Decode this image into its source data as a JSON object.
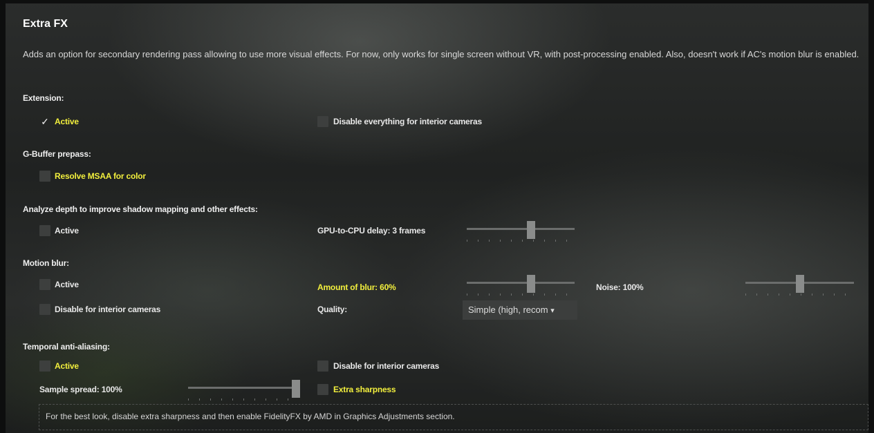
{
  "title": "Extra FX",
  "description": "Adds an option for secondary rendering pass allowing to use more visual effects. For now, only works for single screen without VR, with post-processing enabled. Also, doesn't work if AC's motion blur is enabled.",
  "extension": {
    "heading": "Extension:",
    "active": {
      "label": "Active",
      "checked": true
    },
    "disable_interior": {
      "label": "Disable everything for interior cameras",
      "checked": false
    }
  },
  "gbuffer": {
    "heading": "G-Buffer prepass:",
    "resolve_msaa": {
      "label": "Resolve MSAA for color",
      "checked": false
    }
  },
  "depth": {
    "heading": "Analyze depth to improve shadow mapping and other effects:",
    "active": {
      "label": "Active",
      "checked": false
    },
    "delay_label": "GPU-to-CPU delay: 3 frames",
    "delay_value": 3
  },
  "motion_blur": {
    "heading": "Motion blur:",
    "active": {
      "label": "Active",
      "checked": false
    },
    "disable_interior": {
      "label": "Disable for interior cameras",
      "checked": false
    },
    "amount_label": "Amount of blur: 60%",
    "amount_value": 60,
    "noise_label": "Noise: 100%",
    "noise_value": 100,
    "quality_label": "Quality:",
    "quality_value": "Simple (high, recom",
    "quality_arrow": "▾"
  },
  "taa": {
    "heading": "Temporal anti-aliasing:",
    "active": {
      "label": "Active",
      "checked": false
    },
    "disable_interior": {
      "label": "Disable for interior cameras",
      "checked": false
    },
    "spread_label": "Sample spread: 100%",
    "spread_value": 100,
    "extra_sharpness": {
      "label": "Extra sharpness",
      "checked": false
    }
  },
  "tip": "For the best look, disable extra sharpness and then enable FidelityFX by AMD in Graphics Adjustments section.",
  "icons": {
    "check": "checkmark-icon",
    "dropdown": "chevron-down-icon"
  },
  "colors": {
    "highlight": "#f2ef3d",
    "text": "#e8e8e8",
    "control": "#3d3f3e"
  }
}
